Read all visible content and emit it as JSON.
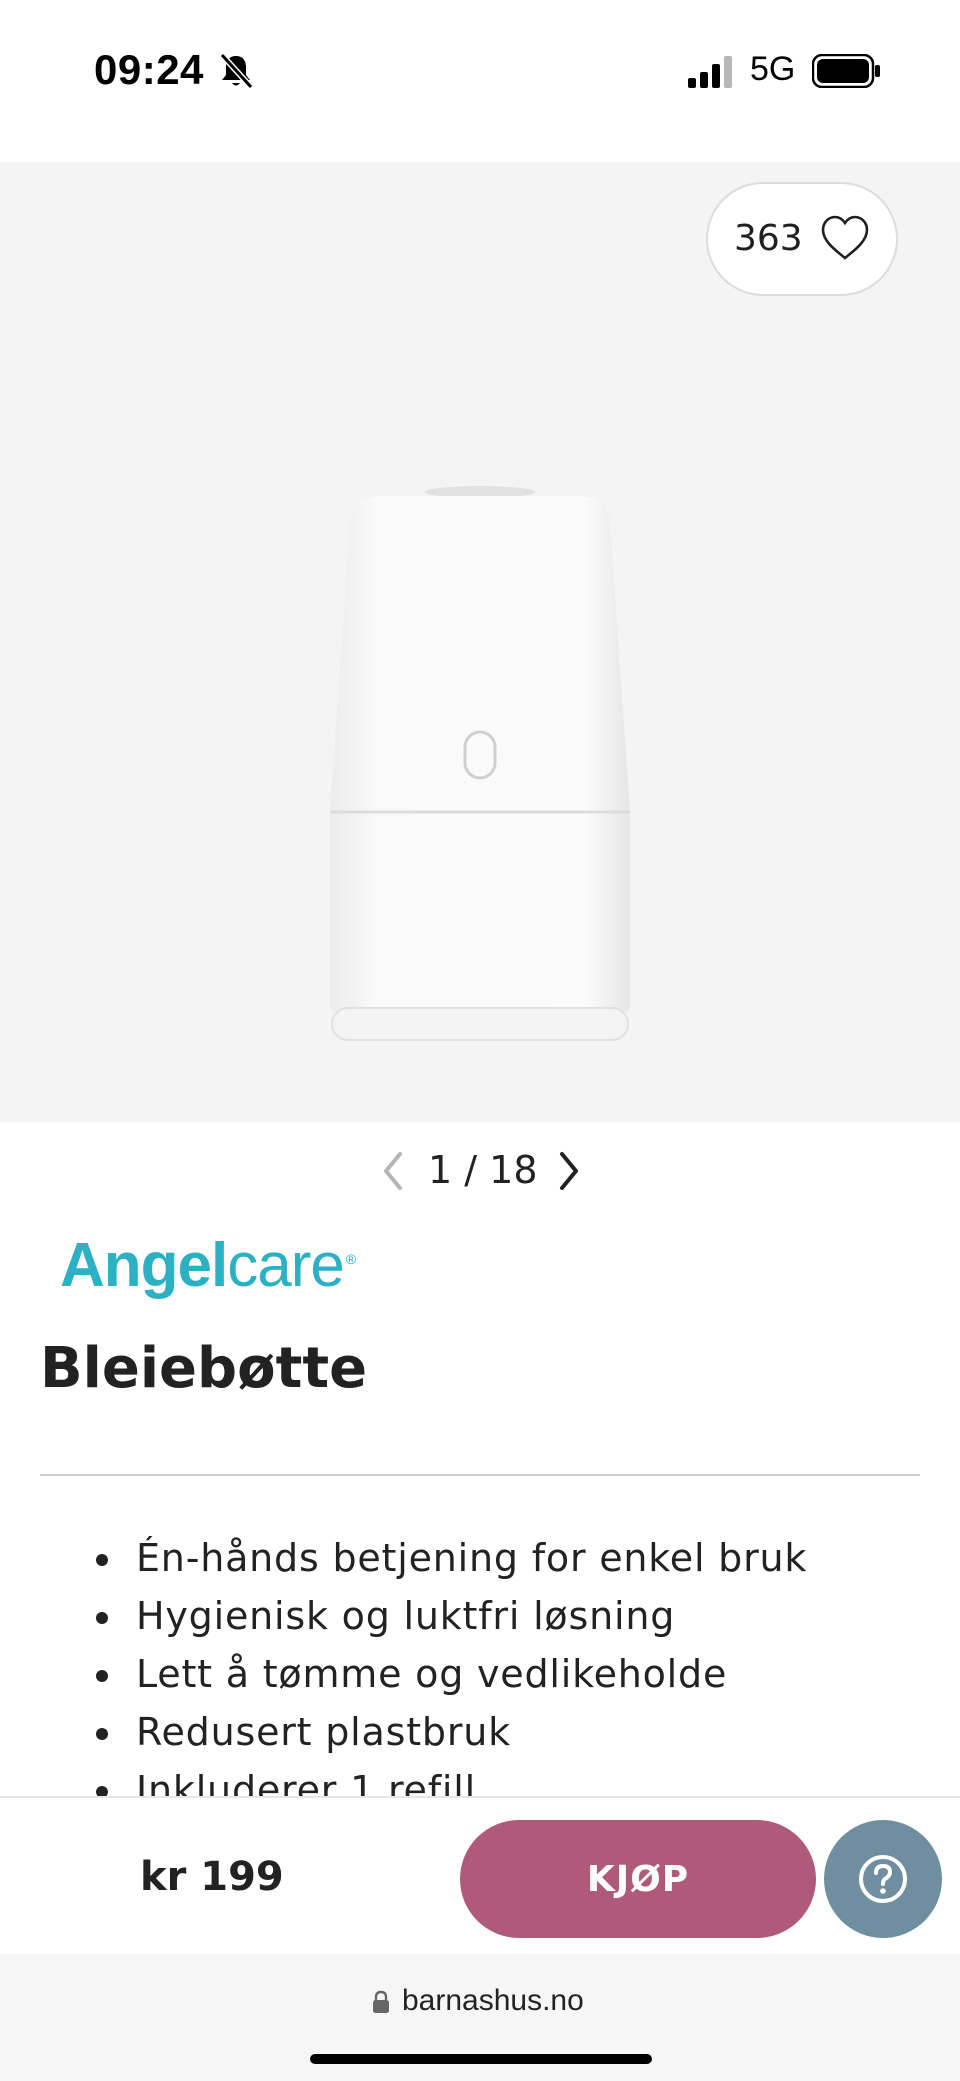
{
  "status_bar": {
    "time": "09:24",
    "network": "5G",
    "icons": [
      "bell-slash-icon",
      "signal-icon",
      "battery-icon"
    ]
  },
  "gallery": {
    "favorite_count": "363",
    "favorite_icon": "heart-icon",
    "pager_text": "1 / 18",
    "current_image": 1,
    "total_images": 18
  },
  "brand": {
    "name_part1": "Angel",
    "name_part2": "care",
    "registered": "®",
    "color": "#2bb0c4"
  },
  "product": {
    "title": "Bleiebøtte",
    "features": [
      "Én-hånds betjening for enkel bruk",
      "Hygienisk og luktfri løsning",
      "Lett å tømme og vedlikeholde",
      "Redusert plastbruk",
      "Inkluderer 1 refill"
    ]
  },
  "buy_bar": {
    "price": "kr 199",
    "buy_label": "KJØP",
    "buy_color": "#b05a7a",
    "help_color": "#6f8fa0",
    "help_icon": "question-icon"
  },
  "browser": {
    "url": "barnashus.no"
  }
}
